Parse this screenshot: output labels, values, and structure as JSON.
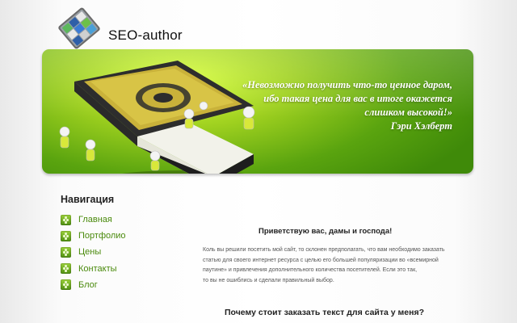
{
  "header": {
    "site_title": "SEO-author",
    "logo_icon": "cube-logo-icon"
  },
  "banner": {
    "quote_lines": [
      "«Невозможно получить что-то ценное даром,",
      "ибо такая цена для вас в итоге окажется",
      "слишком высокой!»"
    ],
    "quote_author": "Гэри Хэлберт",
    "art_icon": "book-with-figures-illustration",
    "colors": {
      "green_light": "#d9ff3a",
      "green_dark": "#3f8a09"
    }
  },
  "navigation": {
    "heading": "Навигация",
    "items": [
      {
        "label": "Главная",
        "icon": "bullet-icon"
      },
      {
        "label": "Портфолио",
        "icon": "bullet-icon"
      },
      {
        "label": "Цены",
        "icon": "bullet-icon"
      },
      {
        "label": "Контакты",
        "icon": "bullet-icon"
      },
      {
        "label": "Блог",
        "icon": "bullet-icon"
      }
    ],
    "link_color": "#4a8a0c"
  },
  "main": {
    "greeting": "Приветствую вас, дамы и господа!",
    "intro_lines": [
      "Коль вы решили посетить мой сайт, то склонен предполагать, что вам необходимо заказать",
      "статью для своего интернет ресурса с целью его большей популяризации во «всемирной",
      "паутине» и привлечения дополнительного количества посетителей. Если это так,",
      "то вы не ошиблись и сделали правильный выбор."
    ],
    "why_heading": "Почему стоит заказать текст для сайта у меня?"
  }
}
